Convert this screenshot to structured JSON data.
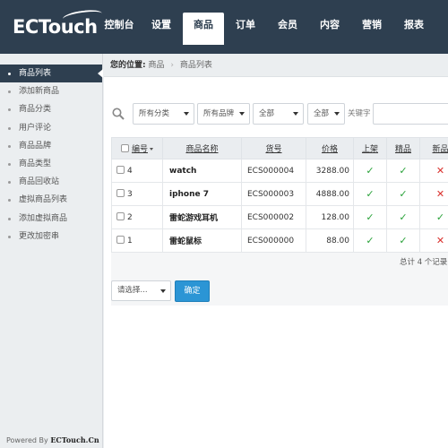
{
  "header": {
    "logo_text": "ECTouch",
    "nav": [
      {
        "label": "控制台",
        "active": false
      },
      {
        "label": "设置",
        "active": false
      },
      {
        "label": "商品",
        "active": true
      },
      {
        "label": "订单",
        "active": false
      },
      {
        "label": "会员",
        "active": false
      },
      {
        "label": "内容",
        "active": false
      },
      {
        "label": "营销",
        "active": false
      },
      {
        "label": "报表",
        "active": false
      }
    ]
  },
  "sidebar": {
    "items": [
      {
        "label": "商品列表",
        "active": true
      },
      {
        "label": "添加新商品"
      },
      {
        "label": "商品分类"
      },
      {
        "label": "用户评论"
      },
      {
        "label": "商品品牌"
      },
      {
        "label": "商品类型"
      },
      {
        "label": "商品回收站"
      },
      {
        "label": "虚拟商品列表"
      },
      {
        "label": "添加虚拟商品"
      },
      {
        "label": "更改加密串"
      }
    ],
    "powered_prefix": "Powered By",
    "powered_brand": "ECTouch.Cn"
  },
  "breadcrumb": {
    "lead": "您的位置:",
    "items": [
      "商品",
      "商品列表"
    ],
    "separator": "›"
  },
  "filters": {
    "category": "所有分类",
    "brand": "所有品牌",
    "status": "全部",
    "intro": "全部",
    "keyword_label": "关键字",
    "keyword_value": ""
  },
  "table": {
    "headers": {
      "id": "编号",
      "name": "商品名称",
      "sn": "货号",
      "price": "价格",
      "on_sale": "上架",
      "best": "精品",
      "new": "新品"
    },
    "rows": [
      {
        "id": "4",
        "name": "watch",
        "sn": "ECS000004",
        "price": "3288.00",
        "on_sale": true,
        "best": true,
        "new": false
      },
      {
        "id": "3",
        "name": "iphone 7",
        "sn": "ECS000003",
        "price": "4888.00",
        "on_sale": true,
        "best": true,
        "new": false
      },
      {
        "id": "2",
        "name": "雷蛇游戏耳机",
        "sn": "ECS000002",
        "price": "128.00",
        "on_sale": true,
        "best": true,
        "new": true
      },
      {
        "id": "1",
        "name": "雷蛇鼠标",
        "sn": "ECS000000",
        "price": "88.00",
        "on_sale": true,
        "best": true,
        "new": false
      }
    ],
    "total_text": "总计 4 个记录"
  },
  "actions": {
    "batch_select": "请选择...",
    "confirm_label": "确定"
  },
  "colors": {
    "header_bg": "#2e3f50",
    "primary_button": "#2b95d5",
    "check": "#2aa23a",
    "cross": "#d9302c"
  },
  "icons": {
    "yes": "✓",
    "no": "✕"
  }
}
